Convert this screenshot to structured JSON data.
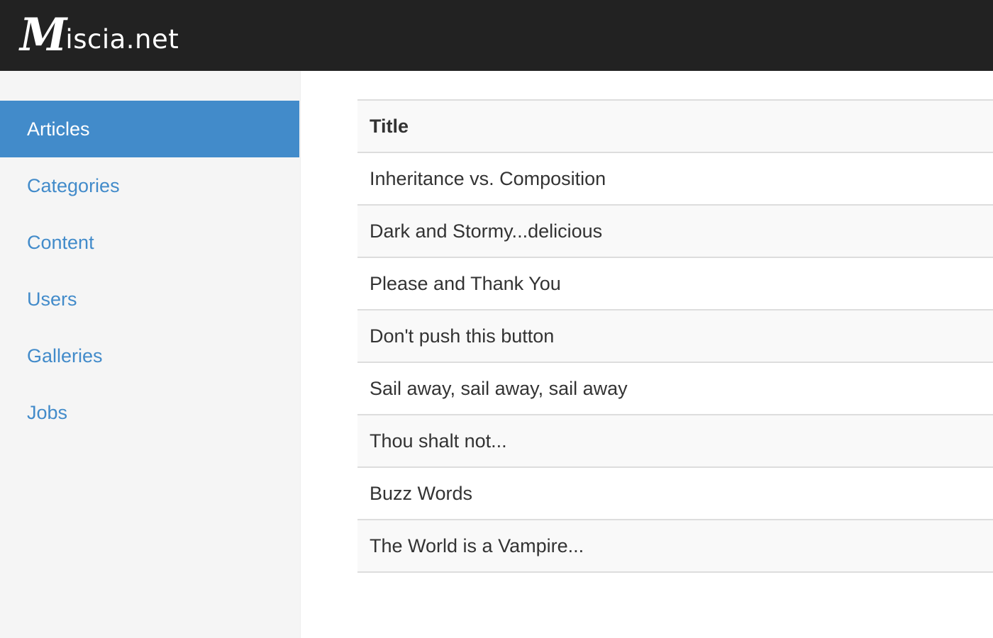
{
  "navbar": {
    "brand_initial": "M",
    "brand_rest": "iscia.net"
  },
  "sidebar": {
    "items": [
      {
        "label": "Articles",
        "active": true
      },
      {
        "label": "Categories",
        "active": false
      },
      {
        "label": "Content",
        "active": false
      },
      {
        "label": "Users",
        "active": false
      },
      {
        "label": "Galleries",
        "active": false
      },
      {
        "label": "Jobs",
        "active": false
      }
    ]
  },
  "table": {
    "header": "Title",
    "rows": [
      "Inheritance vs. Composition",
      "Dark and Stormy...delicious",
      "Please and Thank You",
      "Don't push this button",
      "Sail away, sail away, sail away",
      "Thou shalt not...",
      "Buzz Words",
      "The World is a Vampire..."
    ]
  },
  "colors": {
    "navbar_bg": "#222222",
    "sidebar_bg": "#f5f5f5",
    "accent": "#428bca",
    "text": "#333333"
  }
}
